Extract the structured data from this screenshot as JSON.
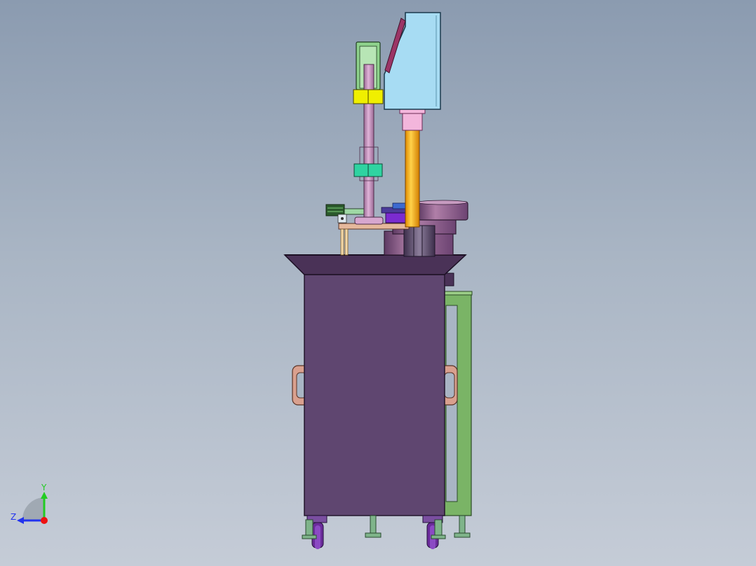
{
  "triad": {
    "y_label": "Y",
    "z_label": "Z",
    "y_color": "#22cc22",
    "z_color": "#2233ee",
    "x_color": "#ee1111"
  },
  "colors": {
    "background_top": "#8b9bb0",
    "background_bottom": "#c5ccd7",
    "cabinet": "#5f4670",
    "hopper_top": "#4a3257",
    "side_frame": "#7ab466",
    "feeder_bowl": "#8e5b8a",
    "column_pink": "#c58fbb",
    "rod_orange": "#f2a000",
    "guard_window": "#a7dcf3",
    "collar_yellow": "#f0ef00",
    "collar_teal": "#2fd3a1",
    "handle": "#c98b7a",
    "caster": "#6a2b9a"
  }
}
